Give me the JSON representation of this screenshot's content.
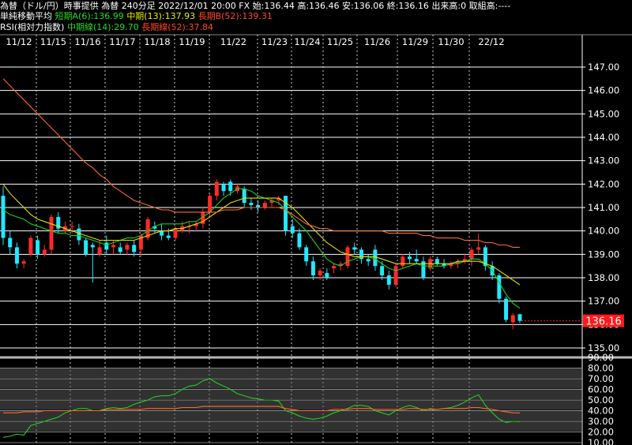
{
  "header": {
    "line1": "為替（ドル/円）時事提供 為替 240分足 2022/12/01 20:00 FX 始:136.44 高:136.46 安:136.06 終:136.16 出来高:0 取組高:----",
    "ma_title": "単純移動平均",
    "ma_short": "短期A(6):136.99",
    "ma_mid": "中期(13):137.93",
    "ma_long": "長期B(52):139.31",
    "rsi_title": "RSI(相対力指数)",
    "rsi_mid": "中期線(14):29.70",
    "rsi_long": "長期線(52):37.84"
  },
  "price_label": "136.16",
  "colors": {
    "bg": "#000000",
    "up": "#ff2a2a",
    "down": "#22e8ff",
    "ma_short": "#22cc22",
    "ma_mid": "#e0e000",
    "ma_long": "#ff6a30",
    "grid": "#ffffff",
    "rsi_band": "#5a5a5a"
  },
  "chart_data": [
    {
      "type": "candlestick",
      "title": "為替（ドル/円）240分足",
      "x_tick_labels": [
        "11/12",
        "11/15",
        "11/16",
        "11/17",
        "11/18",
        "11/19",
        "11/22",
        "11/23",
        "11/24",
        "11/25",
        "11/26",
        "11/29",
        "11/30",
        "22/12"
      ],
      "y_ticks": [
        "135.00",
        "136.00",
        "137.00",
        "138.00",
        "139.00",
        "140.00",
        "141.00",
        "142.00",
        "143.00",
        "144.00",
        "145.00",
        "146.00",
        "147.00"
      ],
      "ylim": [
        134.8,
        147.5
      ],
      "last_price": 136.16,
      "candles": [
        {
          "o": 141.5,
          "h": 141.9,
          "l": 139.4,
          "c": 139.7
        },
        {
          "o": 139.7,
          "h": 140.0,
          "l": 139.0,
          "c": 139.3
        },
        {
          "o": 139.3,
          "h": 139.5,
          "l": 138.4,
          "c": 138.6
        },
        {
          "o": 138.6,
          "h": 138.8,
          "l": 138.4,
          "c": 138.7
        },
        {
          "o": 139.0,
          "h": 139.8,
          "l": 138.9,
          "c": 139.7
        },
        {
          "o": 139.6,
          "h": 139.8,
          "l": 138.8,
          "c": 139.0
        },
        {
          "o": 139.0,
          "h": 139.4,
          "l": 138.9,
          "c": 139.2
        },
        {
          "o": 139.2,
          "h": 140.7,
          "l": 139.0,
          "c": 140.6
        },
        {
          "o": 140.6,
          "h": 140.8,
          "l": 139.9,
          "c": 140.1
        },
        {
          "o": 140.0,
          "h": 140.4,
          "l": 139.9,
          "c": 140.2
        },
        {
          "o": 140.2,
          "h": 140.4,
          "l": 139.9,
          "c": 140.2
        },
        {
          "o": 140.1,
          "h": 140.3,
          "l": 139.4,
          "c": 139.6
        },
        {
          "o": 139.6,
          "h": 139.7,
          "l": 138.9,
          "c": 139.0
        },
        {
          "o": 139.4,
          "h": 139.5,
          "l": 137.8,
          "c": 139.3
        },
        {
          "o": 139.0,
          "h": 139.6,
          "l": 138.9,
          "c": 139.3
        },
        {
          "o": 139.5,
          "h": 139.8,
          "l": 139.0,
          "c": 139.2
        },
        {
          "o": 139.3,
          "h": 139.6,
          "l": 139.0,
          "c": 139.4
        },
        {
          "o": 139.3,
          "h": 139.5,
          "l": 139.0,
          "c": 139.1
        },
        {
          "o": 139.2,
          "h": 139.5,
          "l": 139.0,
          "c": 139.4
        },
        {
          "o": 139.4,
          "h": 139.6,
          "l": 138.9,
          "c": 139.1
        },
        {
          "o": 139.2,
          "h": 139.9,
          "l": 138.9,
          "c": 139.8
        },
        {
          "o": 139.7,
          "h": 140.6,
          "l": 139.6,
          "c": 140.5
        },
        {
          "o": 140.2,
          "h": 140.4,
          "l": 139.9,
          "c": 140.1
        },
        {
          "o": 140.0,
          "h": 140.3,
          "l": 139.6,
          "c": 139.8
        },
        {
          "o": 139.8,
          "h": 140.1,
          "l": 139.6,
          "c": 139.7
        },
        {
          "o": 139.7,
          "h": 140.2,
          "l": 139.6,
          "c": 140.1
        },
        {
          "o": 140.0,
          "h": 140.4,
          "l": 139.9,
          "c": 140.2
        },
        {
          "o": 140.2,
          "h": 140.4,
          "l": 139.9,
          "c": 140.2
        },
        {
          "o": 140.2,
          "h": 140.4,
          "l": 140.0,
          "c": 140.3
        },
        {
          "o": 140.3,
          "h": 141.0,
          "l": 140.1,
          "c": 140.8
        },
        {
          "o": 140.8,
          "h": 141.6,
          "l": 140.6,
          "c": 141.5
        },
        {
          "o": 141.5,
          "h": 142.2,
          "l": 141.3,
          "c": 142.1
        },
        {
          "o": 142.0,
          "h": 142.1,
          "l": 141.5,
          "c": 141.7
        },
        {
          "o": 142.1,
          "h": 142.2,
          "l": 141.5,
          "c": 141.7
        },
        {
          "o": 141.7,
          "h": 142.0,
          "l": 141.6,
          "c": 141.9
        },
        {
          "o": 141.8,
          "h": 141.9,
          "l": 141.0,
          "c": 141.2
        },
        {
          "o": 141.2,
          "h": 141.4,
          "l": 140.9,
          "c": 141.1
        },
        {
          "o": 141.1,
          "h": 141.3,
          "l": 140.8,
          "c": 141.0
        },
        {
          "o": 141.0,
          "h": 141.3,
          "l": 140.9,
          "c": 141.2
        },
        {
          "o": 141.2,
          "h": 141.4,
          "l": 141.0,
          "c": 141.3
        },
        {
          "o": 141.3,
          "h": 141.5,
          "l": 141.1,
          "c": 141.4
        },
        {
          "o": 141.5,
          "h": 141.5,
          "l": 139.8,
          "c": 140.0
        },
        {
          "o": 140.2,
          "h": 140.5,
          "l": 139.7,
          "c": 139.9
        },
        {
          "o": 139.9,
          "h": 140.1,
          "l": 139.2,
          "c": 139.3
        },
        {
          "o": 139.3,
          "h": 139.4,
          "l": 138.5,
          "c": 138.7
        },
        {
          "o": 138.7,
          "h": 138.9,
          "l": 137.9,
          "c": 138.1
        },
        {
          "o": 138.1,
          "h": 138.4,
          "l": 137.9,
          "c": 138.3
        },
        {
          "o": 138.2,
          "h": 138.4,
          "l": 137.9,
          "c": 138.0
        },
        {
          "o": 138.4,
          "h": 138.6,
          "l": 138.2,
          "c": 138.5
        },
        {
          "o": 138.5,
          "h": 138.7,
          "l": 138.3,
          "c": 138.6
        },
        {
          "o": 138.5,
          "h": 139.4,
          "l": 138.4,
          "c": 139.3
        },
        {
          "o": 139.3,
          "h": 139.5,
          "l": 139.0,
          "c": 139.2
        },
        {
          "o": 139.2,
          "h": 139.3,
          "l": 138.6,
          "c": 138.8
        },
        {
          "o": 138.8,
          "h": 139.0,
          "l": 138.5,
          "c": 138.7
        },
        {
          "o": 139.2,
          "h": 139.4,
          "l": 138.3,
          "c": 138.5
        },
        {
          "o": 138.5,
          "h": 138.7,
          "l": 137.9,
          "c": 138.1
        },
        {
          "o": 138.1,
          "h": 138.3,
          "l": 137.5,
          "c": 137.7
        },
        {
          "o": 137.7,
          "h": 138.6,
          "l": 137.6,
          "c": 138.5
        },
        {
          "o": 138.5,
          "h": 139.0,
          "l": 138.4,
          "c": 138.9
        },
        {
          "o": 138.9,
          "h": 139.1,
          "l": 138.6,
          "c": 138.8
        },
        {
          "o": 138.8,
          "h": 139.2,
          "l": 138.6,
          "c": 138.7
        },
        {
          "o": 138.7,
          "h": 138.9,
          "l": 137.9,
          "c": 138.0
        },
        {
          "o": 138.4,
          "h": 138.9,
          "l": 138.3,
          "c": 138.8
        },
        {
          "o": 138.8,
          "h": 138.9,
          "l": 138.5,
          "c": 138.6
        },
        {
          "o": 138.6,
          "h": 138.8,
          "l": 138.4,
          "c": 138.5
        },
        {
          "o": 138.5,
          "h": 138.7,
          "l": 138.4,
          "c": 138.6
        },
        {
          "o": 138.6,
          "h": 138.8,
          "l": 138.4,
          "c": 138.7
        },
        {
          "o": 138.7,
          "h": 139.0,
          "l": 138.6,
          "c": 138.8
        },
        {
          "o": 138.8,
          "h": 139.3,
          "l": 138.5,
          "c": 139.2
        },
        {
          "o": 139.2,
          "h": 139.9,
          "l": 139.0,
          "c": 139.3
        },
        {
          "o": 139.3,
          "h": 139.4,
          "l": 138.3,
          "c": 138.5
        },
        {
          "o": 138.5,
          "h": 138.7,
          "l": 137.9,
          "c": 138.1
        },
        {
          "o": 138.1,
          "h": 138.2,
          "l": 136.9,
          "c": 137.1
        },
        {
          "o": 137.1,
          "h": 137.2,
          "l": 136.1,
          "c": 136.2
        },
        {
          "o": 136.1,
          "h": 136.5,
          "l": 135.8,
          "c": 136.4
        },
        {
          "o": 136.44,
          "h": 136.46,
          "l": 136.06,
          "c": 136.16
        }
      ],
      "series": [
        {
          "name": "短期A(6)",
          "y": [
            140.9,
            140.7,
            140.6,
            140.5,
            140.3,
            140.2,
            140.1,
            140.0,
            139.9,
            139.9,
            139.8,
            139.8,
            139.7,
            139.6,
            139.5,
            139.4,
            139.5,
            139.6,
            139.7,
            139.7,
            139.8,
            140.0,
            140.2,
            140.3,
            140.3,
            140.3,
            140.3,
            140.4,
            140.4,
            140.6,
            140.8,
            141.1,
            141.4,
            141.6,
            141.8,
            141.8,
            141.7,
            141.5,
            141.4,
            141.3,
            141.2,
            140.9,
            140.6,
            140.3,
            140.0,
            139.6,
            139.2,
            138.8,
            138.6,
            138.5,
            138.7,
            138.8,
            138.9,
            138.9,
            138.8,
            138.6,
            138.4,
            138.3,
            138.4,
            138.5,
            138.6,
            138.5,
            138.5,
            138.5,
            138.5,
            138.6,
            138.6,
            138.7,
            138.8,
            138.8,
            138.6,
            138.3,
            137.8,
            137.3,
            136.9,
            136.7
          ]
        },
        {
          "name": "中期(13)",
          "y": [
            142.0,
            141.6,
            141.3,
            141.0,
            140.7,
            140.5,
            140.4,
            140.3,
            140.2,
            140.1,
            140.0,
            139.9,
            139.8,
            139.7,
            139.6,
            139.6,
            139.6,
            139.6,
            139.6,
            139.6,
            139.7,
            139.8,
            139.9,
            140.0,
            140.0,
            140.1,
            140.1,
            140.2,
            140.3,
            140.4,
            140.6,
            140.8,
            141.0,
            141.2,
            141.3,
            141.4,
            141.4,
            141.4,
            141.4,
            141.4,
            141.4,
            141.2,
            141.0,
            140.7,
            140.4,
            140.1,
            139.8,
            139.5,
            139.3,
            139.1,
            139.0,
            138.9,
            138.9,
            138.9,
            138.9,
            138.8,
            138.7,
            138.6,
            138.6,
            138.6,
            138.6,
            138.6,
            138.6,
            138.6,
            138.6,
            138.6,
            138.7,
            138.7,
            138.7,
            138.7,
            138.6,
            138.5,
            138.3,
            138.1,
            137.9,
            137.7
          ]
        },
        {
          "name": "長期B(52)",
          "y": [
            146.5,
            146.2,
            145.9,
            145.6,
            145.3,
            145.0,
            144.7,
            144.4,
            144.1,
            143.8,
            143.5,
            143.2,
            142.9,
            142.7,
            142.4,
            142.2,
            141.9,
            141.7,
            141.5,
            141.3,
            141.2,
            141.1,
            141.0,
            140.9,
            140.9,
            140.8,
            140.8,
            140.8,
            140.8,
            140.8,
            140.8,
            140.8,
            140.9,
            140.9,
            140.9,
            141.0,
            141.0,
            141.0,
            141.0,
            141.0,
            141.0,
            140.9,
            140.7,
            140.5,
            140.3,
            140.2,
            140.1,
            140.1,
            140.0,
            140.0,
            140.0,
            140.0,
            140.0,
            140.0,
            140.0,
            140.0,
            139.9,
            139.9,
            139.9,
            139.9,
            139.9,
            139.8,
            139.8,
            139.7,
            139.7,
            139.7,
            139.7,
            139.6,
            139.6,
            139.6,
            139.5,
            139.5,
            139.4,
            139.4,
            139.3,
            139.3
          ]
        }
      ]
    },
    {
      "type": "line",
      "title": "RSI(相対力指数)",
      "y_ticks": [
        "10.00",
        "20.00",
        "30.00",
        "40.00",
        "50.00",
        "60.00",
        "70.00",
        "80.00",
        "90.00"
      ],
      "ylim": [
        10,
        90
      ],
      "bands": [
        [
          20,
          30
        ],
        [
          30,
          40
        ],
        [
          40,
          50
        ],
        [
          50,
          60
        ],
        [
          60,
          70
        ],
        [
          70,
          80
        ]
      ],
      "series": [
        {
          "name": "中期線(14)",
          "y": [
            15,
            16,
            18,
            17,
            26,
            28,
            30,
            32,
            34,
            38,
            40,
            42,
            42,
            40,
            40,
            42,
            43,
            42,
            43,
            46,
            48,
            50,
            53,
            54,
            54,
            56,
            60,
            63,
            64,
            68,
            70,
            66,
            63,
            60,
            56,
            54,
            52,
            51,
            50,
            50,
            49,
            40,
            38,
            35,
            33,
            32,
            33,
            35,
            38,
            40,
            42,
            45,
            45,
            44,
            40,
            38,
            36,
            40,
            43,
            45,
            43,
            40,
            42,
            41,
            42,
            43,
            45,
            48,
            52,
            55,
            45,
            38,
            32,
            29,
            30,
            29.7
          ]
        },
        {
          "name": "長期線(52)",
          "y": [
            38,
            38,
            38,
            39,
            39,
            39,
            40,
            40,
            40,
            40,
            40,
            40,
            40,
            40,
            40,
            41,
            41,
            41,
            41,
            41,
            41,
            42,
            42,
            42,
            42,
            42,
            43,
            43,
            43,
            44,
            44,
            44,
            44,
            44,
            44,
            44,
            44,
            44,
            44,
            44,
            44,
            42,
            41,
            40,
            40,
            40,
            40,
            40,
            41,
            41,
            41,
            42,
            42,
            42,
            41,
            41,
            41,
            41,
            41,
            42,
            42,
            41,
            41,
            41,
            42,
            42,
            42,
            42,
            43,
            43,
            42,
            41,
            40,
            39,
            38,
            37.84
          ]
        }
      ]
    }
  ]
}
